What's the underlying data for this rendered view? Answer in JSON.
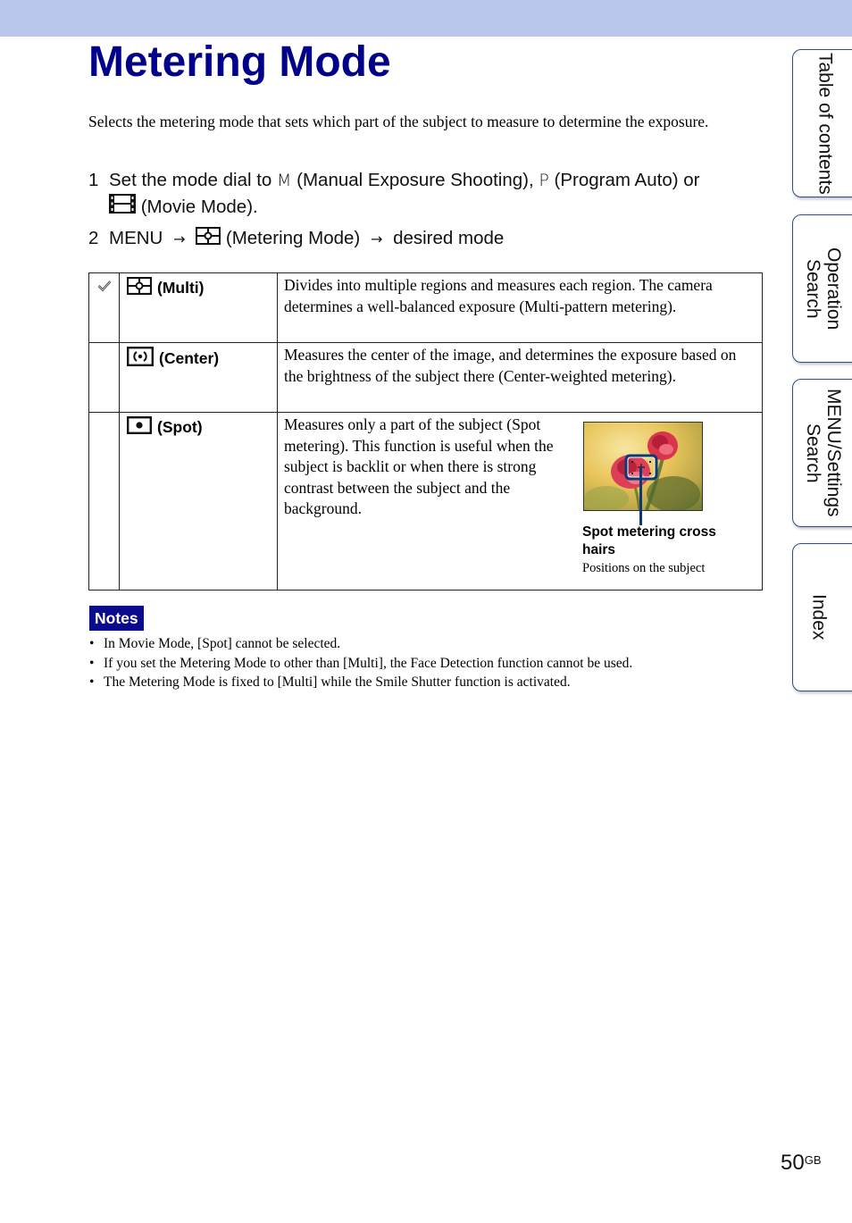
{
  "page": {
    "title": "Metering Mode",
    "intro": "Selects the metering mode that sets which part of the subject to measure to determine the exposure.",
    "steps": [
      {
        "num": "1",
        "text_a": "Set the mode dial to",
        "glyph_m": "M",
        "text_b": "(Manual Exposure Shooting),",
        "glyph_p": "P",
        "text_c": "(Program Auto) or",
        "text_d": "(Movie Mode).",
        "icons": [
          "manual-exposure-icon",
          "program-auto-icon",
          "movie-mode-icon"
        ]
      },
      {
        "num": "2",
        "menu": "MENU",
        "arrow": "→",
        "text_a": "(Metering Mode)",
        "text_b": "desired mode",
        "icons": [
          "metering-mode-icon",
          "arrow-right-icon"
        ]
      }
    ],
    "modes": [
      {
        "default": true,
        "default_icon": "checkmark-icon",
        "icon": "multi-metering-icon",
        "name": "(Multi)",
        "description": "Divides into multiple regions and measures each region. The camera determines a well-balanced exposure (Multi-pattern metering)."
      },
      {
        "default": false,
        "icon": "center-metering-icon",
        "name": "(Center)",
        "description": "Measures the center of the image, and determines the exposure based on the brightness of the subject there (Center-weighted metering)."
      },
      {
        "default": false,
        "icon": "spot-metering-icon",
        "name": "(Spot)",
        "description": "Measures only a part of the subject (Spot metering). This function is useful when the subject is backlit or when there is strong contrast between the subject and the background.",
        "figure": {
          "caption_title": "Spot metering cross hairs",
          "caption_sub": "Positions on the subject"
        }
      }
    ],
    "notes": {
      "label": "Notes",
      "items": [
        "In Movie Mode, [Spot] cannot be selected.",
        "If you set the Metering Mode to other than [Multi], the Face Detection function cannot be used.",
        "The Metering Mode is fixed to [Multi] while the Smile Shutter function is activated."
      ]
    },
    "page_number": "50",
    "page_suffix": "GB"
  },
  "side_tabs": [
    {
      "label": "Table of contents"
    },
    {
      "label": "Operation Search"
    },
    {
      "label": "MENU/Settings Search"
    },
    {
      "label": "Index"
    }
  ],
  "colors": {
    "title": "#00008b",
    "top_bar": "#b9c7eb",
    "notes_badge": "#0a0a8c",
    "tab_border": "#2b4f8a"
  }
}
